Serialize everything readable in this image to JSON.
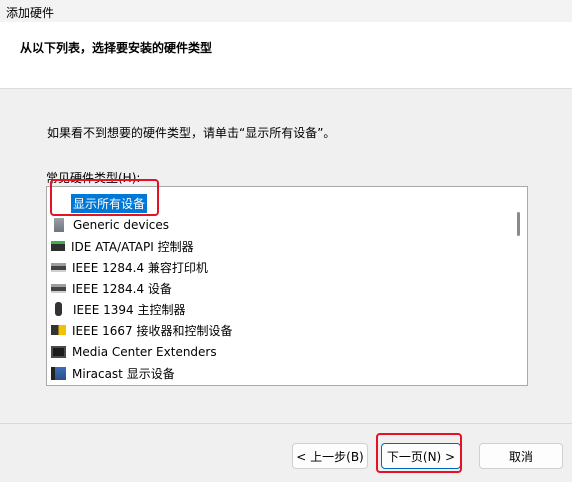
{
  "window": {
    "title": "添加硬件"
  },
  "header": {
    "heading": "从以下列表，选择要安装的硬件类型"
  },
  "main": {
    "instruction": "如果看不到想要的硬件类型，请单击“显示所有设备”。",
    "list_label": "常见硬件类型(H):",
    "items": [
      {
        "label": "显示所有设备",
        "icon": "display-all-devices-icon",
        "selected": true
      },
      {
        "label": "Generic devices",
        "icon": "generic-device-icon",
        "selected": false
      },
      {
        "label": "IDE ATA/ATAPI 控制器",
        "icon": "ide-controller-icon",
        "selected": false
      },
      {
        "label": "IEEE 1284.4 兼容打印机",
        "icon": "printer-icon",
        "selected": false
      },
      {
        "label": "IEEE 1284.4 设备",
        "icon": "printer-device-icon",
        "selected": false
      },
      {
        "label": "IEEE 1394 主控制器",
        "icon": "usb-controller-icon",
        "selected": false
      },
      {
        "label": "IEEE 1667 接收器和控制设备",
        "icon": "ieee1667-device-icon",
        "selected": false
      },
      {
        "label": "Media Center Extenders",
        "icon": "media-center-extender-icon",
        "selected": false
      },
      {
        "label": "Miracast 显示设备",
        "icon": "miracast-display-icon",
        "selected": false
      }
    ]
  },
  "footer": {
    "back_label": "< 上一步(B)",
    "next_label": "下一页(N) >",
    "cancel_label": "取消"
  },
  "colors": {
    "selection": "#0078d7",
    "highlight_box": "#e81123",
    "default_button_border": "#0067c0"
  }
}
